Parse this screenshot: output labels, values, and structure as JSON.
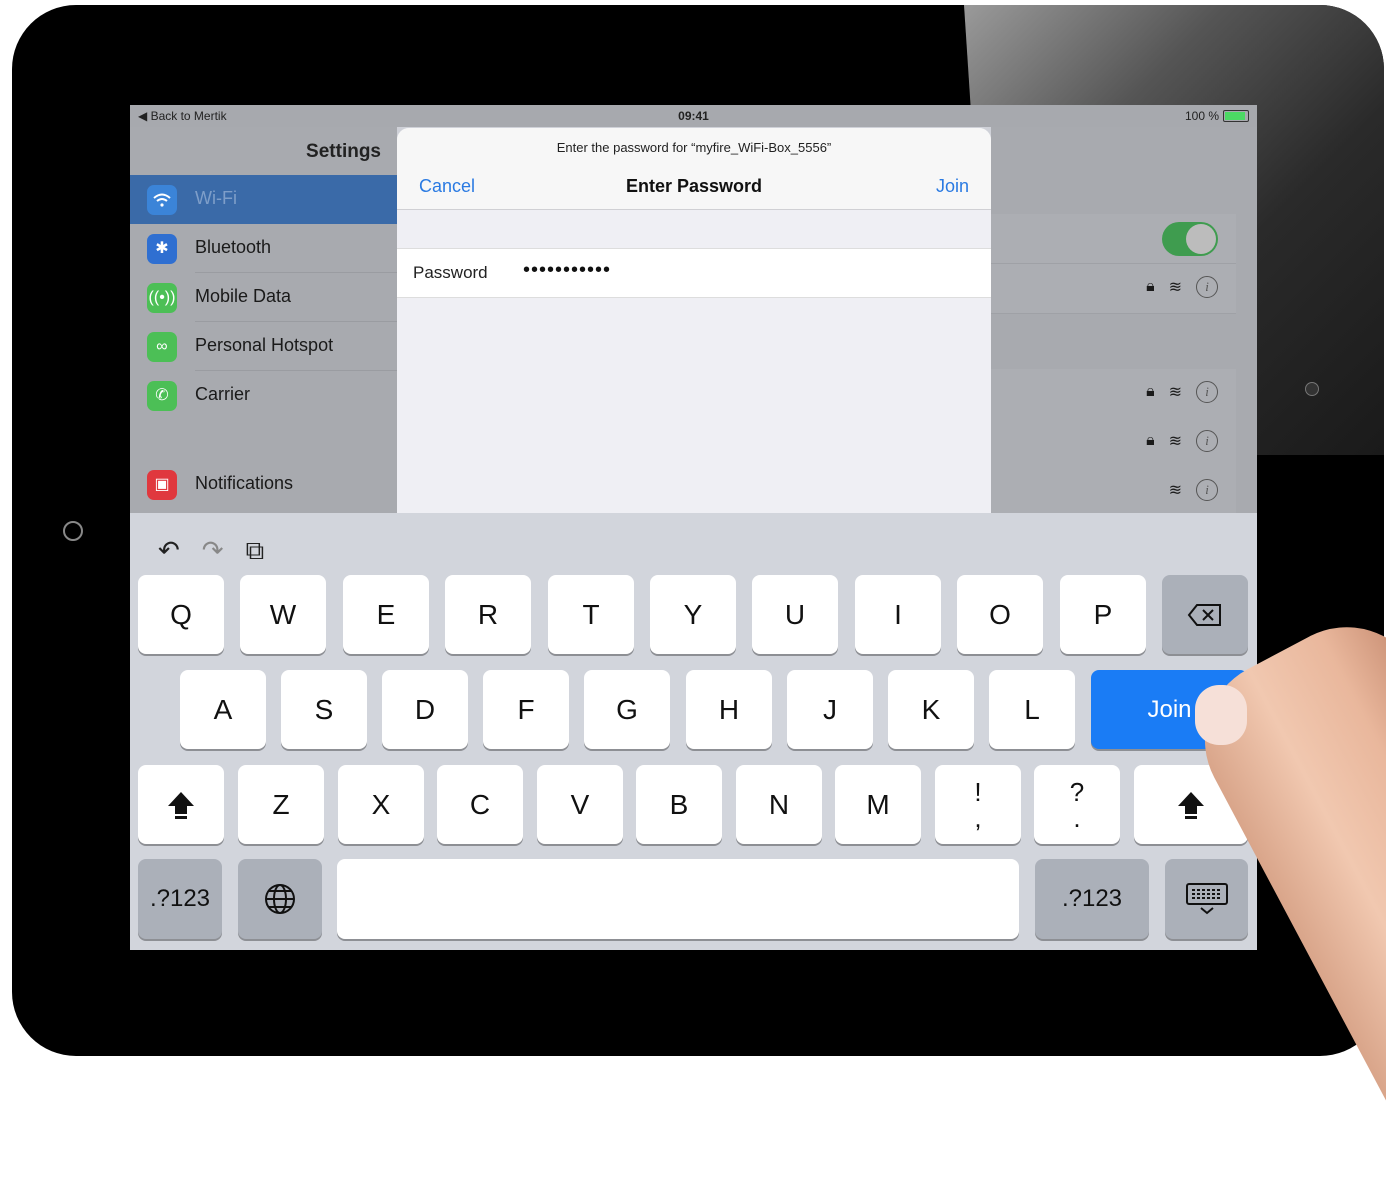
{
  "status_bar": {
    "back_label": "◀ Back to Mertik",
    "time": "09:41",
    "battery": "100 %",
    "battery_fraction": 1.0
  },
  "sidebar": {
    "title": "Settings",
    "items": [
      {
        "label": "Wi-Fi",
        "icon": "wifi-icon",
        "color": "#3b84d8",
        "active": true
      },
      {
        "label": "Bluetooth",
        "icon": "bluetooth-icon",
        "color": "#2f6fd1"
      },
      {
        "label": "Mobile Data",
        "icon": "antenna-icon",
        "color": "#4cbf56"
      },
      {
        "label": "Personal Hotspot",
        "icon": "hotspot-icon",
        "color": "#4cbf56"
      },
      {
        "label": "Carrier",
        "icon": "phone-icon",
        "color": "#4cbf56"
      },
      {
        "label": "Notifications",
        "icon": "notifications-icon",
        "color": "#e0383e"
      }
    ]
  },
  "modal": {
    "prompt": "Enter the password for “myfire_WiFi-Box_5556”",
    "cancel_label": "Cancel",
    "title": "Enter Password",
    "join_label": "Join",
    "password_label": "Password",
    "password_value": "•••••••••••"
  },
  "keyboard": {
    "row1": [
      "Q",
      "W",
      "E",
      "R",
      "T",
      "Y",
      "U",
      "I",
      "O",
      "P"
    ],
    "row2": [
      "A",
      "S",
      "D",
      "F",
      "G",
      "H",
      "J",
      "K",
      "L"
    ],
    "row3": [
      "Z",
      "X",
      "C",
      "V",
      "B",
      "N",
      "M"
    ],
    "punct1": {
      "top": "!",
      "bottom": ","
    },
    "punct2": {
      "top": "?",
      "bottom": "."
    },
    "join_label": "Join",
    "numbers_label": ".?123",
    "space_label": ""
  },
  "colors": {
    "accent": "#2a7ae2",
    "join_key": "#1a7cf5",
    "toggle_on": "#3f9c4f"
  }
}
